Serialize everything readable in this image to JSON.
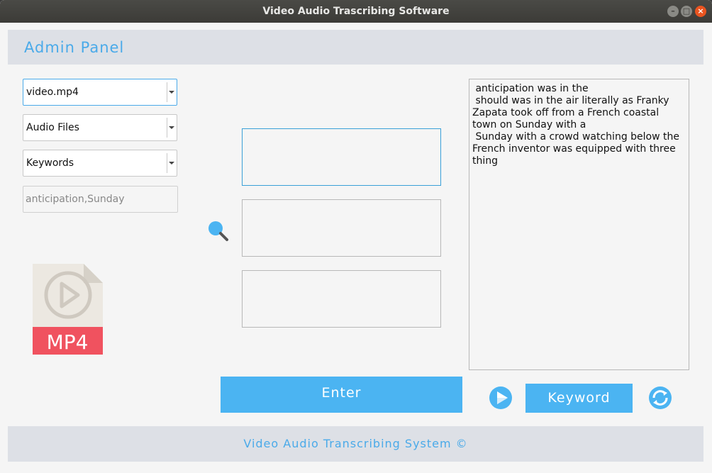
{
  "window": {
    "title": "Video Audio Trascribing Software"
  },
  "header": {
    "title": "Admin Panel"
  },
  "left": {
    "file_combo": "video.mp4",
    "type_combo": "Audio Files",
    "mode_combo": "Keywords",
    "keywords_value": "anticipation,Sunday",
    "file_icon_label": "MP4"
  },
  "transcript": {
    "text": " anticipation was in the\n should was in the air literally as Franky Zapata took off from a French coastal town on Sunday with a\n Sunday with a crowd watching below the French inventor was equipped with three thing"
  },
  "buttons": {
    "enter": "Enter",
    "keyword": "Keyword"
  },
  "footer": {
    "text": "Video Audio Transcribing System ©"
  },
  "colors": {
    "accent": "#4bb4f2",
    "title_text": "#4aaae9",
    "panel_bg": "#dde0e6",
    "mp4_red": "#f0525f"
  },
  "icons": [
    "close-icon",
    "minimize-icon",
    "maximize-icon",
    "search-icon",
    "play-icon",
    "refresh-icon",
    "mp4-file-icon",
    "dropdown-arrow-icon"
  ]
}
